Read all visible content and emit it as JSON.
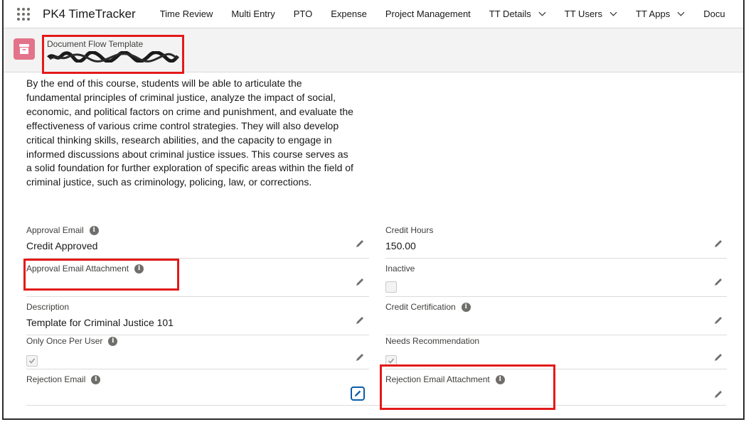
{
  "nav": {
    "app_name": "PK4 TimeTracker",
    "items": [
      {
        "label": "Time Review"
      },
      {
        "label": "Multi Entry"
      },
      {
        "label": "PTO"
      },
      {
        "label": "Expense"
      },
      {
        "label": "Project Management"
      },
      {
        "label": "TT Details"
      },
      {
        "label": "TT Users"
      },
      {
        "label": "TT Apps"
      },
      {
        "label": "Docu"
      }
    ]
  },
  "header": {
    "object_type": "Document Flow Template",
    "record_name_redacted": "Criminal Justice 101"
  },
  "description_text": "By the end of this course, students will be able to articulate the fundamental principles of criminal justice, analyze the impact of social, economic, and political factors on crime and punishment, and evaluate the effectiveness of various crime control strategies. They will also develop critical thinking skills, research abilities, and the capacity to engage in informed discussions about criminal justice issues. This course serves as a solid foundation for further exploration of specific areas within the field of criminal justice, such as criminology, policing, law, or corrections.",
  "fields": {
    "approval_email": {
      "label": "Approval Email",
      "value": "Credit Approved"
    },
    "credit_hours": {
      "label": "Credit Hours",
      "value": "150.00"
    },
    "approval_email_attachment": {
      "label": "Approval Email Attachment",
      "value": ""
    },
    "inactive": {
      "label": "Inactive",
      "checked": false
    },
    "description": {
      "label": "Description",
      "value": "Template for Criminal Justice 101"
    },
    "credit_certification": {
      "label": "Credit Certification",
      "value": ""
    },
    "only_once_per_user": {
      "label": "Only Once Per User",
      "checked": true
    },
    "needs_recommendation": {
      "label": "Needs Recommendation",
      "checked": true
    },
    "rejection_email": {
      "label": "Rejection Email",
      "value": ""
    },
    "rejection_email_attachment": {
      "label": "Rejection Email Attachment",
      "value": ""
    }
  },
  "colors": {
    "record_icon": "#e3738a",
    "highlight_box": "#e31a1a",
    "edit_focus": "#0b5cab"
  }
}
